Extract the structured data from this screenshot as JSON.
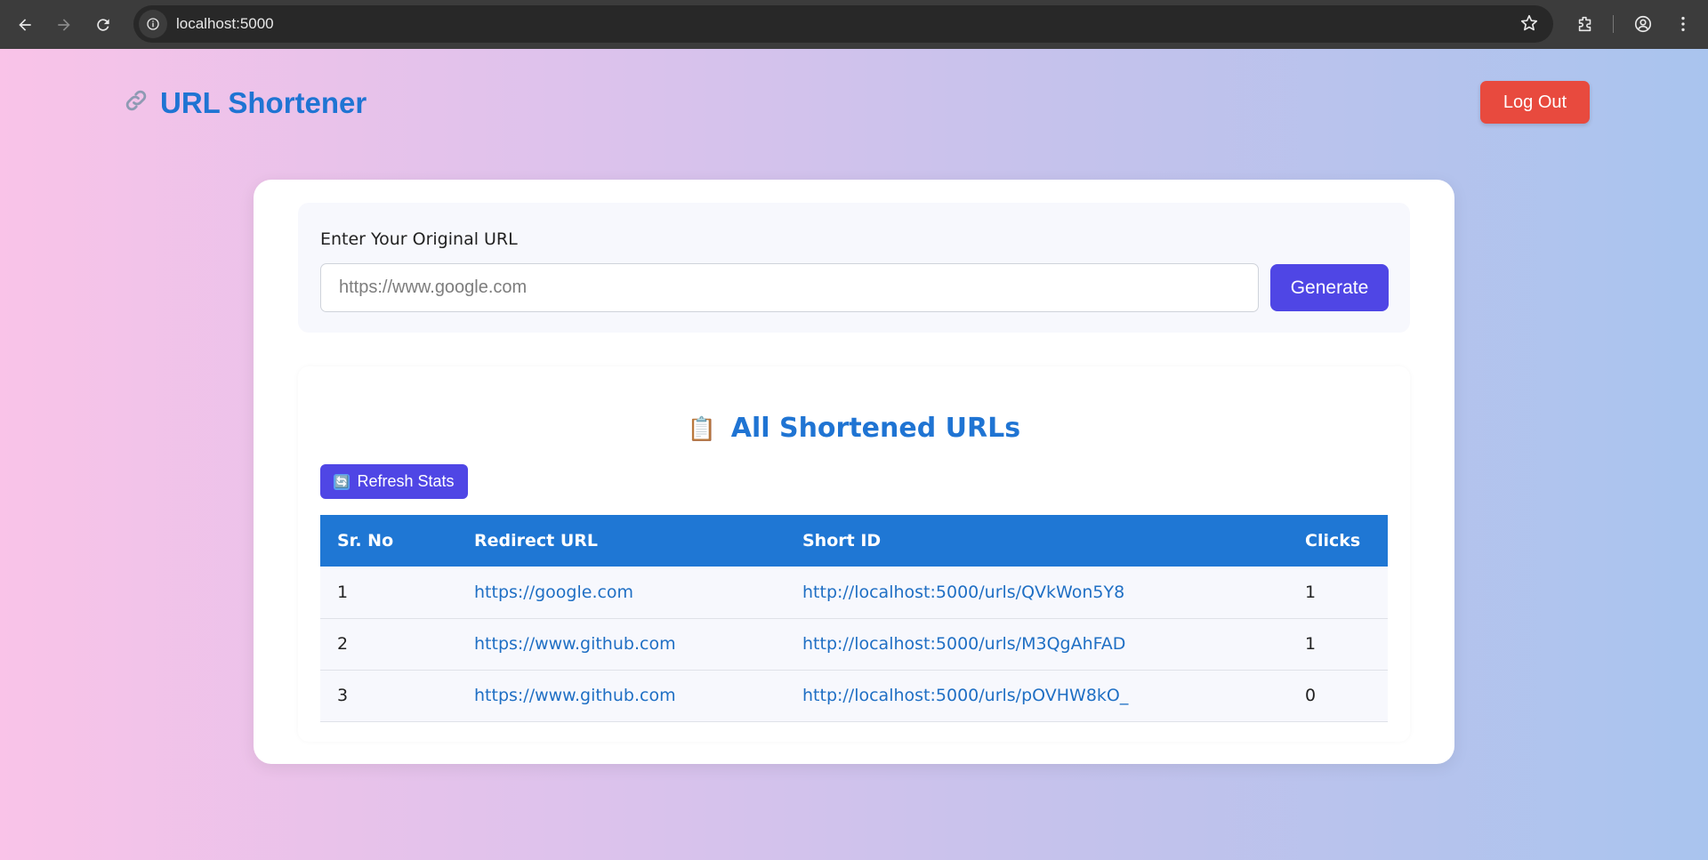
{
  "browser": {
    "url": "localhost:5000"
  },
  "app": {
    "title": "URL Shortener",
    "logout_label": "Log Out"
  },
  "form": {
    "label": "Enter Your Original URL",
    "input_value": "",
    "input_placeholder": "https://www.google.com",
    "generate_label": "Generate"
  },
  "stats": {
    "heading": "All Shortened URLs",
    "refresh_label": "Refresh Stats",
    "columns": [
      "Sr. No",
      "Redirect URL",
      "Short ID",
      "Clicks"
    ],
    "rows": [
      {
        "sr": "1",
        "redirect": "https://google.com",
        "short": "http://localhost:5000/urls/QVkWon5Y8",
        "clicks": "1"
      },
      {
        "sr": "2",
        "redirect": "https://www.github.com",
        "short": "http://localhost:5000/urls/M3QgAhFAD",
        "clicks": "1"
      },
      {
        "sr": "3",
        "redirect": "https://www.github.com",
        "short": "http://localhost:5000/urls/pOVHW8kO_",
        "clicks": "0"
      }
    ]
  },
  "colors": {
    "brand_blue": "#1f74d3",
    "primary_button": "#4f46e5",
    "logout_button": "#e84a3e",
    "table_header": "#1f77d4"
  },
  "icons": {
    "brand": "link-icon",
    "heading": "clipboard-icon",
    "refresh": "refresh-icon"
  }
}
